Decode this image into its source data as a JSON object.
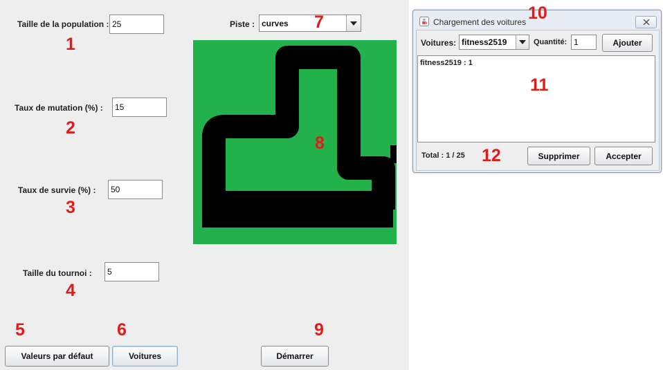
{
  "main_window": {
    "population_size": {
      "label": "Taille de la population :",
      "value": "25",
      "marker": "1"
    },
    "mutation_rate": {
      "label": "Taux de mutation (%) :",
      "value": "15",
      "marker": "2"
    },
    "survival_rate": {
      "label": "Taux de survie (%) :",
      "value": "50",
      "marker": "3"
    },
    "tournament_size": {
      "label": "Taille du tournoi :",
      "value": "5",
      "marker": "4"
    },
    "track_selector": {
      "label": "Piste :",
      "selected": "curves",
      "marker": "7"
    },
    "track_preview": {
      "marker": "8",
      "background_color": "#23b14c",
      "track_color": "#000000"
    },
    "buttons": {
      "defaults": {
        "label": "Valeurs par défaut",
        "marker": "5"
      },
      "cars": {
        "label": "Voitures",
        "marker": "6"
      },
      "start": {
        "label": "Démarrer",
        "marker": "9"
      }
    }
  },
  "car_dialog": {
    "title": "Chargement des voitures",
    "title_marker": "10",
    "cars_label": "Voitures:",
    "cars_selected": "fitness2519",
    "quantity_label": "Quantité:",
    "quantity_value": "1",
    "add_button": "Ajouter",
    "list_items": [
      "fitness2519 : 1"
    ],
    "list_marker": "11",
    "total_text": "Total : 1 / 25",
    "total_marker": "12",
    "remove_button": "Supprimer",
    "accept_button": "Accepter"
  },
  "icons": {
    "dropdown": "chevron-down-icon",
    "dialog_app": "java-cup-icon",
    "dialog_close": "close-icon"
  },
  "colors": {
    "marker": "#df1c1c",
    "track_background": "#23b14c",
    "track": "#000000",
    "window_background": "#eeeeee",
    "dialog_frame": "#e8edf3"
  }
}
